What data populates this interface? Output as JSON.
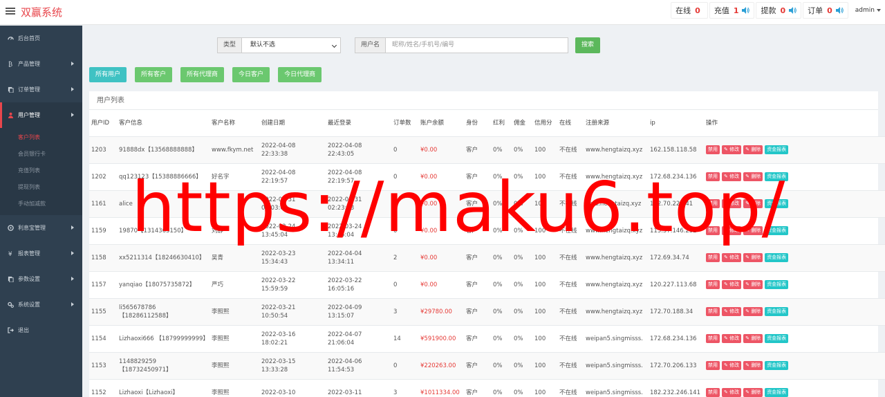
{
  "header": {
    "brand": "双赢系统",
    "stats": [
      {
        "label": "在线",
        "value": "0"
      },
      {
        "label": "充值",
        "value": "1"
      },
      {
        "label": "提款",
        "value": "0"
      },
      {
        "label": "订单",
        "value": "0"
      }
    ],
    "admin": "admin"
  },
  "sidebar": {
    "items": [
      {
        "label": "后台首页",
        "icon": "dashboard-icon"
      },
      {
        "label": "产品管理",
        "icon": "bitcoin-icon"
      },
      {
        "label": "订单管理",
        "icon": "copy-icon"
      },
      {
        "label": "用户管理",
        "icon": "user-icon"
      },
      {
        "label": "利息宝管理",
        "icon": "gear-circle-icon"
      },
      {
        "label": "报表管理",
        "icon": "yen-icon"
      },
      {
        "label": "参数设置",
        "icon": "copy-icon"
      },
      {
        "label": "系统设置",
        "icon": "cogs-icon"
      },
      {
        "label": "退出",
        "icon": "sign-out-icon"
      }
    ],
    "user_sub": [
      "客户列表",
      "会员银行卡",
      "充值列表",
      "提现列表",
      "手动加减款"
    ]
  },
  "search": {
    "type_label": "类型",
    "type_value": "默认不选",
    "username_label": "用户名",
    "username_placeholder": "昵称/姓名/手机号/编号",
    "search_button": "搜索"
  },
  "filters": [
    "所有用户",
    "所有客户",
    "所有代理商",
    "今日客户",
    "今日代理商"
  ],
  "panel_title": "用户列表",
  "table": {
    "headers": [
      "用户ID",
      "客户信息",
      "客户名称",
      "创建日期",
      "最近登录",
      "订单数",
      "账户余额",
      "身份",
      "红利",
      "佣金",
      "信用分",
      "在线",
      "注册来源",
      "ip",
      "操作"
    ],
    "op_labels": [
      "禁用",
      "修改",
      "删除",
      "资金报表"
    ],
    "rows": [
      {
        "id": "1203",
        "info": "91888dx【13568888888】",
        "name": "www.fkym.net",
        "created": "2022-04-08 22:33:38",
        "login": "2022-04-08 22:43:05",
        "orders": "0",
        "balance": "¥0.00",
        "role": "客户",
        "bonus": "0%",
        "comm": "0%",
        "credit": "100",
        "online": "不在线",
        "source": "www.hengtaizq.xyz",
        "ip": "162.158.118.58"
      },
      {
        "id": "1202",
        "info": "qq123123【15388886666】",
        "name": "好名字",
        "created": "2022-04-08 22:19:57",
        "login": "2022-04-08 22:19:57",
        "orders": "0",
        "balance": "¥0.00",
        "role": "客户",
        "bonus": "0%",
        "comm": "0%",
        "credit": "100",
        "online": "不在线",
        "source": "www.hengtaizq.xyz",
        "ip": "172.68.234.136"
      },
      {
        "id": "1161",
        "info": "alice",
        "name": "",
        "created": "2022-03-31 02:03:08",
        "login": "2022-03-31 02:23:08",
        "orders": "0",
        "balance": "¥0.00",
        "role": "客户",
        "bonus": "0%",
        "comm": "0%",
        "credit": "100",
        "online": "不在线",
        "source": "kefu.hengtaizq.xyz",
        "ip": "172.70.221.41"
      },
      {
        "id": "1159",
        "info": "19870【1314363150】",
        "name": "刘静",
        "created": "2022-03-24 13:45:04",
        "login": "2022-03-24 13:45:04",
        "orders": "0",
        "balance": "¥0.00",
        "role": "客户",
        "bonus": "0%",
        "comm": "0%",
        "credit": "100",
        "online": "不在线",
        "source": "www.hengtaizq.xyz",
        "ip": "115.57.146.232"
      },
      {
        "id": "1158",
        "info": "xx5211314【18246630410】",
        "name": "吴青",
        "created": "2022-03-23 15:34:43",
        "login": "2022-04-04 13:34:11",
        "orders": "2",
        "balance": "¥0.00",
        "role": "客户",
        "bonus": "0%",
        "comm": "0%",
        "credit": "100",
        "online": "不在线",
        "source": "www.hengtaizq.xyz",
        "ip": "172.69.34.74"
      },
      {
        "id": "1157",
        "info": "yanqiao【18075735872】",
        "name": "严巧",
        "created": "2022-03-22 15:59:59",
        "login": "2022-03-22 16:05:16",
        "orders": "0",
        "balance": "¥0.00",
        "role": "客户",
        "bonus": "0%",
        "comm": "0%",
        "credit": "100",
        "online": "不在线",
        "source": "www.hengtaizq.xyz",
        "ip": "120.227.113.68"
      },
      {
        "id": "1155",
        "info": "li565678786 【18286112588】",
        "name": "李照熙",
        "created": "2022-03-21 10:50:54",
        "login": "2022-04-09 13:15:07",
        "orders": "3",
        "balance": "¥29780.00",
        "role": "客户",
        "bonus": "0%",
        "comm": "0%",
        "credit": "100",
        "online": "不在线",
        "source": "www.hengtaizq.xyz",
        "ip": "172.70.188.34"
      },
      {
        "id": "1154",
        "info": "Lizhaoxi666 【18799999999】",
        "name": "李照熙",
        "created": "2022-03-16 18:02:21",
        "login": "2022-04-07 21:06:04",
        "orders": "14",
        "balance": "¥591900.00",
        "role": "客户",
        "bonus": "0%",
        "comm": "0%",
        "credit": "100",
        "online": "不在线",
        "source": "weipan5.singmisss.",
        "ip": "172.68.234.136"
      },
      {
        "id": "1153",
        "info": "1148829259 【18732450971】",
        "name": "李照熙",
        "created": "2022-03-15 13:33:28",
        "login": "2022-04-06 11:54:53",
        "orders": "0",
        "balance": "¥220263.00",
        "role": "客户",
        "bonus": "0%",
        "comm": "0%",
        "credit": "100",
        "online": "不在线",
        "source": "weipan5.singmisss.",
        "ip": "172.70.206.133"
      },
      {
        "id": "1152",
        "info": "Lizhaoxi【Lizhaoxi】",
        "name": "李照熙",
        "created": "2022-03-10",
        "login": "2022-03-11",
        "orders": "3",
        "balance": "¥1011334.00",
        "role": "客户",
        "bonus": "0%",
        "comm": "0%",
        "credit": "100",
        "online": "不在线",
        "source": "weipan5.singmisss.",
        "ip": "182.232.246.141"
      }
    ]
  },
  "watermark": "https://maku6.top/"
}
